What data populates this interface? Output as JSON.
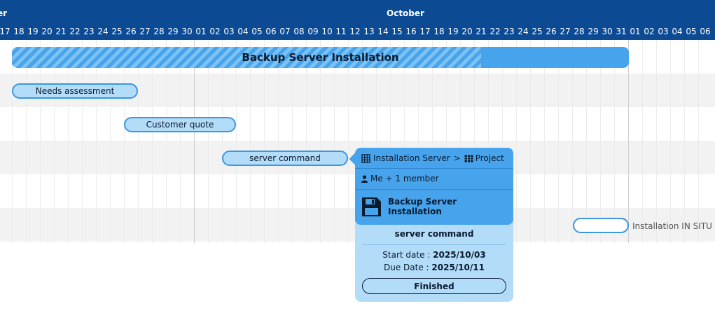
{
  "timeline": {
    "months": [
      {
        "label": "er"
      },
      {
        "label": "October"
      }
    ],
    "days": [
      "17",
      "18",
      "19",
      "20",
      "21",
      "22",
      "23",
      "24",
      "25",
      "26",
      "27",
      "28",
      "29",
      "30",
      "01",
      "02",
      "03",
      "04",
      "05",
      "06",
      "07",
      "08",
      "09",
      "10",
      "11",
      "12",
      "13",
      "14",
      "15",
      "16",
      "17",
      "18",
      "19",
      "20",
      "21",
      "22",
      "23",
      "24",
      "25",
      "26",
      "27",
      "28",
      "29",
      "30",
      "31",
      "01",
      "02",
      "03",
      "04",
      "05",
      "06"
    ]
  },
  "summary": {
    "label": "Backup Server Installation",
    "progress": 0.76
  },
  "tasks": [
    {
      "label": "Needs assessment"
    },
    {
      "label": "Customer quote"
    },
    {
      "label": "server command"
    },
    {
      "label": "",
      "outside_label": "Installation IN SITU"
    }
  ],
  "popup": {
    "breadcrumb_workspace": "Installation Server",
    "breadcrumb_separator": ">",
    "breadcrumb_project": "Project",
    "members": "Me + 1 member",
    "project_name": "Backup Server Installation",
    "task_name": "server command",
    "start_label": "Start date : ",
    "start_value": "2025/10/03",
    "due_label": "Due Date : ",
    "due_value": "2025/10/11",
    "status": "Finished"
  },
  "colors": {
    "header_bg": "#0c4a94",
    "bar_accent": "#46a3ec",
    "task_fill": "#b3dcf9",
    "task_border": "#3b97e3"
  },
  "icons": {
    "workspace": "grid-icon",
    "project": "table-icon",
    "members": "user-icon",
    "project_type": "floppy-disk-icon"
  }
}
